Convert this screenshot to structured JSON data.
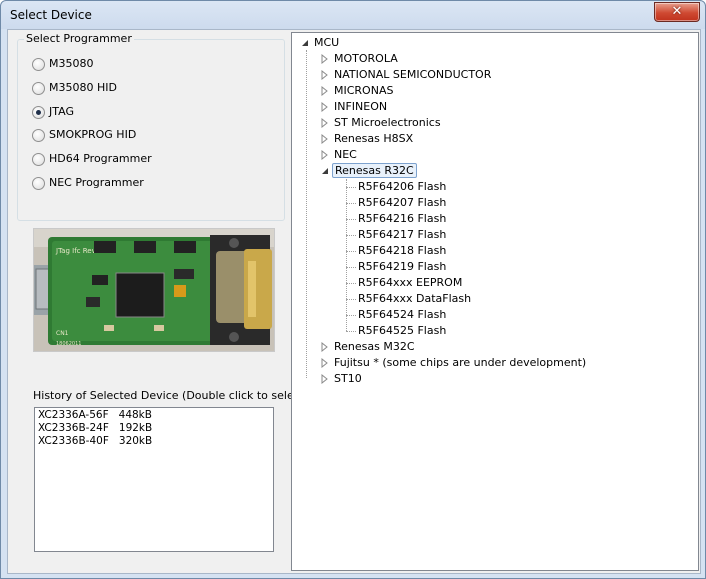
{
  "window": {
    "title": "Select Device",
    "close_label": "✕"
  },
  "programmer": {
    "legend": "Select Programmer",
    "options": [
      {
        "label": "M35080",
        "checked": false
      },
      {
        "label": "M35080 HID",
        "checked": false
      },
      {
        "label": "JTAG",
        "checked": true
      },
      {
        "label": "SMOKPROG HID",
        "checked": false
      },
      {
        "label": "HD64 Programmer",
        "checked": false
      },
      {
        "label": "NEC Programmer",
        "checked": false
      }
    ]
  },
  "board": {
    "silkscreen": "JTag Ifc Rev.C",
    "bottom_text": "18062011",
    "cn_text": "CN1"
  },
  "history": {
    "label": "History of Selected Device (Double click to select)",
    "items": [
      "XC2336A-56F   448kB",
      "XC2336B-24F   192kB",
      "XC2336B-40F   320kB"
    ]
  },
  "tree": {
    "root": "MCU",
    "vendors": [
      {
        "label": "MOTOROLA"
      },
      {
        "label": "NATIONAL SEMICONDUCTOR"
      },
      {
        "label": "MICRONAS"
      },
      {
        "label": "INFINEON"
      },
      {
        "label": "ST Microelectronics"
      },
      {
        "label": "Renesas H8SX"
      },
      {
        "label": "NEC"
      },
      {
        "label": "Renesas R32C",
        "expanded": true,
        "selected": true,
        "children": [
          "R5F64206 Flash",
          "R5F64207 Flash",
          "R5F64216 Flash",
          "R5F64217 Flash",
          "R5F64218 Flash",
          "R5F64219 Flash",
          "R5F64xxx EEPROM",
          "R5F64xxx DataFlash",
          "R5F64524 Flash",
          "R5F64525 Flash"
        ]
      },
      {
        "label": "Renesas M32C"
      },
      {
        "label": "Fujitsu * (some chips are under development)"
      },
      {
        "label": "ST10"
      }
    ]
  }
}
